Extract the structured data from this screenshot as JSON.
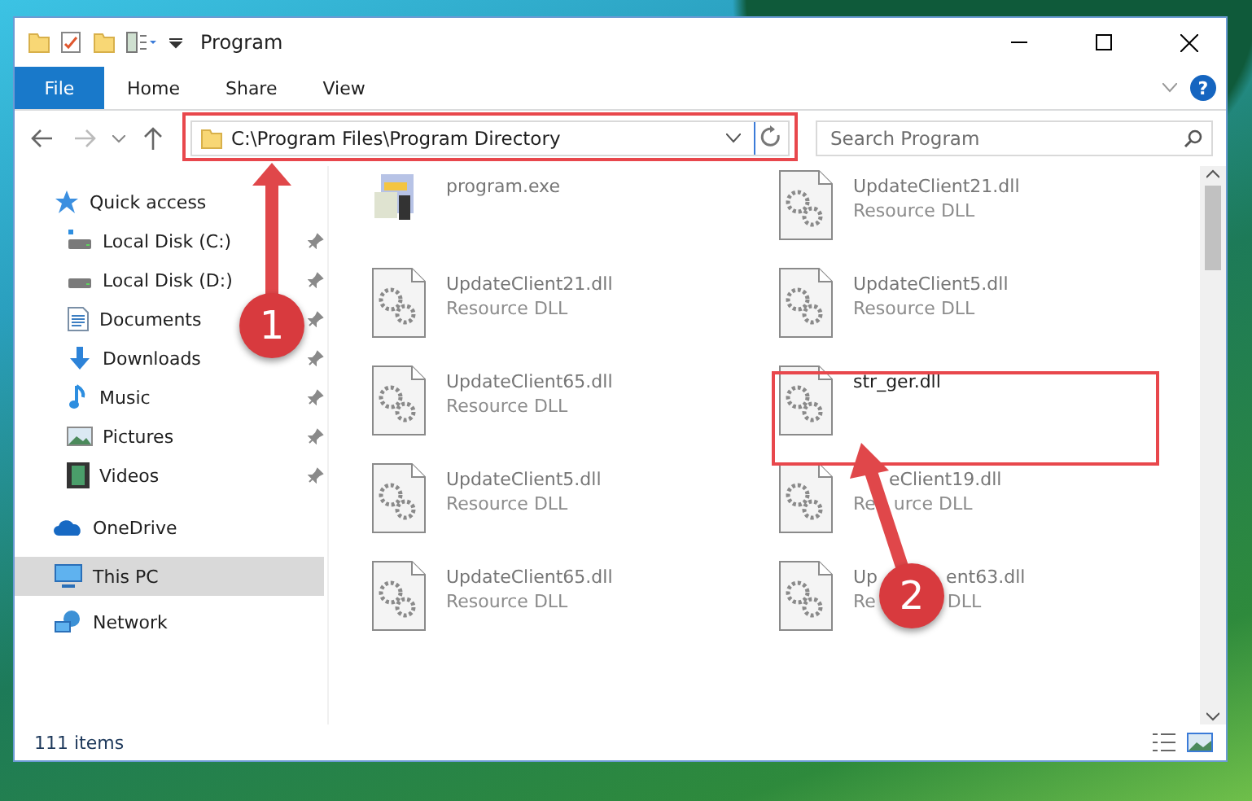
{
  "window": {
    "title": "Program"
  },
  "ribbon": {
    "tabs": [
      {
        "label": "File",
        "selected": true
      },
      {
        "label": "Home",
        "selected": false
      },
      {
        "label": "Share",
        "selected": false
      },
      {
        "label": "View",
        "selected": false
      }
    ],
    "help": "?"
  },
  "address": {
    "path": "C:\\Program Files\\Program Directory"
  },
  "search": {
    "placeholder": "Search Program"
  },
  "sidebar": {
    "items": [
      {
        "label": "Quick access",
        "selected": false,
        "children": [
          {
            "label": "Local Disk (C:)",
            "pinned": true
          },
          {
            "label": "Local Disk (D:)",
            "pinned": true
          },
          {
            "label": "Documents",
            "pinned": true
          },
          {
            "label": "Downloads",
            "pinned": true
          },
          {
            "label": "Music",
            "pinned": true
          },
          {
            "label": "Pictures",
            "pinned": true
          },
          {
            "label": "Videos",
            "pinned": true
          }
        ]
      },
      {
        "label": "OneDrive",
        "selected": false
      },
      {
        "label": "This PC",
        "selected": true
      },
      {
        "label": "Network",
        "selected": false
      }
    ]
  },
  "files": [
    {
      "name": [
        "program.exe"
      ],
      "kind": "exe",
      "blurred": true
    },
    {
      "name": [
        "UpdateClient21.dll"
      ],
      "type": [
        "Resource DLL"
      ],
      "kind": "dll",
      "blurred": true
    },
    {
      "name": [
        "UpdateClient21.dll"
      ],
      "type": [
        "Resource DLL"
      ],
      "kind": "dll",
      "blurred": true
    },
    {
      "name": [
        "UpdateClient5.dll"
      ],
      "type": [
        "Resource DLL"
      ],
      "kind": "dll",
      "blurred": true
    },
    {
      "name": [
        "UpdateClient65.dll"
      ],
      "type": [
        "Resource DLL"
      ],
      "kind": "dll",
      "blurred": true
    },
    {
      "name": [
        "str_ger.dll"
      ],
      "kind": "dll",
      "blurred": false
    },
    {
      "name": [
        "UpdateClient5.dll"
      ],
      "type": [
        "Resource DLL"
      ],
      "kind": "dll",
      "blurred": true
    },
    {
      "name": [
        "eClient19.dll"
      ],
      "type": [
        "Re",
        "urce DLL"
      ],
      "kind": "dll",
      "blurred": true
    },
    {
      "name": [
        "UpdateClient65.dll"
      ],
      "type": [
        "Resource DLL"
      ],
      "kind": "dll",
      "blurred": true
    },
    {
      "name": [
        "Up",
        "ent63.dll"
      ],
      "type": [
        "Re",
        "DLL"
      ],
      "kind": "dll",
      "blurred": true
    }
  ],
  "status_bar": {
    "count": "111 items"
  },
  "annotations": [
    {
      "number": "1"
    },
    {
      "number": "2"
    }
  ]
}
